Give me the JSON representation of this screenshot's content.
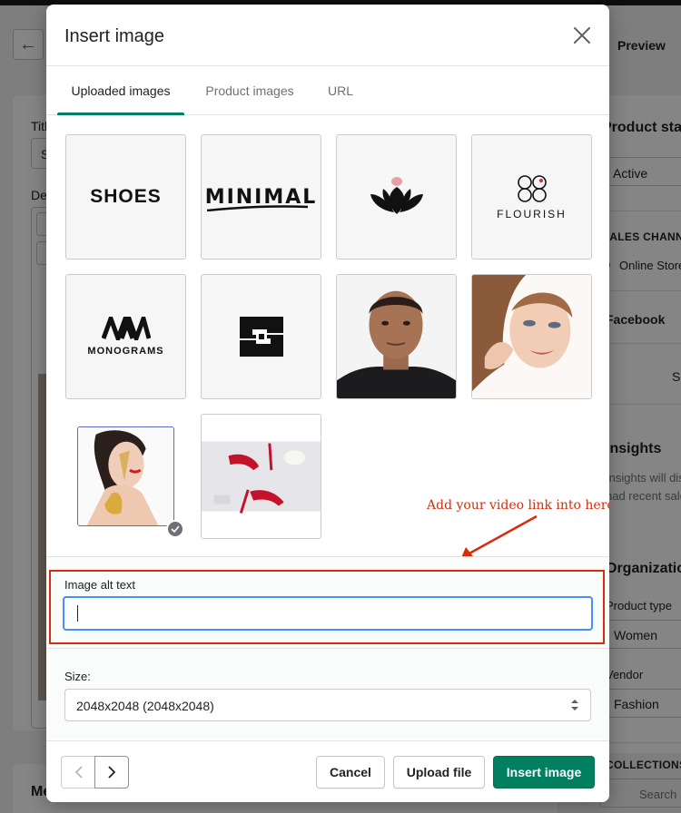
{
  "background": {
    "preview_label": "Preview",
    "title_label": "Title",
    "title_value": "S",
    "description_label": "Description",
    "media_heading": "Media",
    "product_status_heading": "Product status",
    "status_value": "Active",
    "sales_channels_label": "SALES CHANNELS",
    "online_store_label": "Online Store",
    "facebook_label": "Facebook",
    "schedule_fragment": "Sl",
    "insights_heading": "Insights",
    "insights_line1": "Insights will display",
    "insights_line2": "had recent sales",
    "organization_heading": "Organization",
    "product_type_label": "Product type",
    "product_type_value": "Women",
    "vendor_label": "Vendor",
    "vendor_value": "Fashion",
    "collections_label": "COLLECTIONS",
    "collections_search_placeholder": "Search"
  },
  "modal": {
    "title": "Insert image",
    "tabs": [
      {
        "label": "Uploaded images",
        "active": true
      },
      {
        "label": "Product images",
        "active": false
      },
      {
        "label": "URL",
        "active": false
      }
    ],
    "images": [
      {
        "kind": "logo",
        "label": "SHOES"
      },
      {
        "kind": "logo",
        "label": "MINIMAL"
      },
      {
        "kind": "logo",
        "label": "lotus logo"
      },
      {
        "kind": "logo",
        "label": "FLOURISH"
      },
      {
        "kind": "logo",
        "label": "MONOGRAMS"
      },
      {
        "kind": "logo",
        "label": "S monogram logo"
      },
      {
        "kind": "photo",
        "label": "man portrait"
      },
      {
        "kind": "photo",
        "label": "woman makeup portrait"
      },
      {
        "kind": "photo",
        "label": "woman gold makeup",
        "selected": true
      },
      {
        "kind": "photo",
        "label": "red high heels"
      }
    ],
    "annotation": "Add your video link into here",
    "alt_text": {
      "label": "Image alt text",
      "value": "",
      "placeholder": ""
    },
    "size": {
      "label": "Size:",
      "selected": "2048x2048 (2048x2048)"
    },
    "footer": {
      "cancel_label": "Cancel",
      "upload_label": "Upload file",
      "insert_label": "Insert image"
    }
  },
  "colors": {
    "primary": "#008060",
    "annotation": "#d82c0d",
    "focus": "#458fff"
  }
}
